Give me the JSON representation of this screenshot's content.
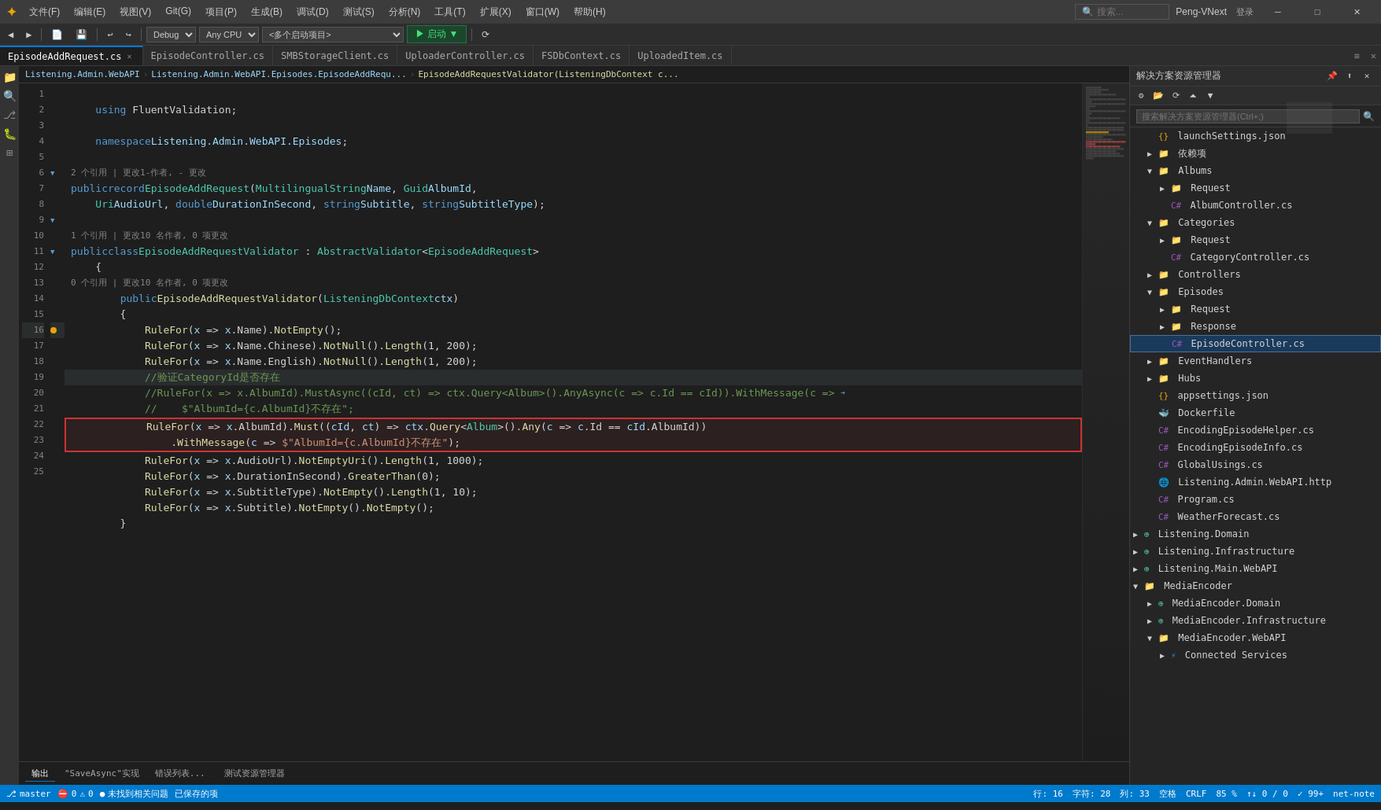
{
  "titleBar": {
    "logo": "✦",
    "menuItems": [
      "文件(F)",
      "编辑(E)",
      "视图(V)",
      "Git(G)",
      "项目(P)",
      "生成(B)",
      "调试(D)",
      "测试(S)",
      "分析(N)",
      "工具(T)",
      "扩展(X)",
      "窗口(W)",
      "帮助(H)"
    ],
    "searchPlaceholder": "搜索...",
    "windowTitle": "Peng-VNext",
    "loginText": "登录",
    "minBtn": "─",
    "maxBtn": "□",
    "closeBtn": "✕"
  },
  "toolbar": {
    "navBack": "◀",
    "navForward": "▶",
    "debugSelect": "Debug",
    "cpuSelect": "Any CPU",
    "startupSelect": "<多个启动项目>",
    "runBtn": "▶ 启动 ▼",
    "otherBtns": "⟳"
  },
  "tabs": [
    {
      "label": "EpisodeAddRequest.cs",
      "active": true,
      "modified": false
    },
    {
      "label": "EpisodeController.cs",
      "active": false,
      "modified": false
    },
    {
      "label": "SMBStorageClient.cs",
      "active": false
    },
    {
      "label": "UploaderController.cs",
      "active": false
    },
    {
      "label": "FSDbContext.cs",
      "active": false
    },
    {
      "label": "UploadedItem.cs",
      "active": false
    }
  ],
  "breadcrumb": {
    "namespace": "Listening.Admin.WebAPI",
    "path": "Listening.Admin.WebAPI.Episodes.EpisodeAddRequ...",
    "member": "EpisodeAddRequestValidator(ListeningDbContext c..."
  },
  "code": {
    "lines": [
      {
        "num": 1,
        "content": "",
        "gutter": ""
      },
      {
        "num": 2,
        "content": "    using FluentValidation;",
        "gutter": ""
      },
      {
        "num": 3,
        "content": "",
        "gutter": ""
      },
      {
        "num": 4,
        "content": "    namespace Listening.Admin.WebAPI.Episodes;",
        "gutter": ""
      },
      {
        "num": 5,
        "content": "",
        "gutter": ""
      },
      {
        "num": 6,
        "content": "public record EpisodeAddRequest(MultilingualString Name, Guid AlbumId,",
        "gutter": "",
        "refs": "2 个引用 | 更改1-作者, - 更改"
      },
      {
        "num": 7,
        "content": "    Uri AudioUrl, double DurationInSecond, string Subtitle, string SubtitleType);",
        "gutter": ""
      },
      {
        "num": 8,
        "content": "",
        "gutter": ""
      },
      {
        "num": 9,
        "content": "public class EpisodeAddRequestValidator : AbstractValidator<EpisodeAddRequest>",
        "gutter": "",
        "refs": "1 个引用 | 更改10 名作者, 0 项更改"
      },
      {
        "num": 10,
        "content": "    {",
        "gutter": ""
      },
      {
        "num": 11,
        "content": "        public EpisodeAddRequestValidator(ListeningDbContext ctx)",
        "gutter": "",
        "refs": "0 个引用 | 更改10 名作者, 0 项更改"
      },
      {
        "num": 12,
        "content": "        {",
        "gutter": ""
      },
      {
        "num": 13,
        "content": "            RuleFor(x => x.Name).NotEmpty();",
        "gutter": ""
      },
      {
        "num": 14,
        "content": "            RuleFor(x => x.Name.Chinese).NotNull().Length(1, 200);",
        "gutter": ""
      },
      {
        "num": 15,
        "content": "            RuleFor(x => x.Name.English).NotNull().Length(1, 200);",
        "gutter": ""
      },
      {
        "num": 16,
        "content": "            //验证CategoryId是否存在",
        "gutter": "dot",
        "current": true
      },
      {
        "num": 17,
        "content": "            //RuleFor(x => x.AlbumId).MustAsync((cId, ct) => ctx.Query<Album>().AnyAsync(c => c.Id == cId)).WithMessage(c =>",
        "gutter": ""
      },
      {
        "num": 18,
        "content": "            //    $\"AlbumId={c.AlbumId}不存在\";",
        "gutter": ""
      },
      {
        "num": 19,
        "content": "            RuleFor(x => x.AlbumId).Must((cId, ct) => ctx.Query<Album>().Any(c => c.Id == cId.AlbumId))",
        "gutter": ""
      },
      {
        "num": 20,
        "content": "                .WithMessage(c => $\"AlbumId={c.AlbumId}不存在\");",
        "gutter": ""
      },
      {
        "num": 21,
        "content": "            RuleFor(x => x.AudioUrl).NotEmptyUri().Length(1, 1000);",
        "gutter": ""
      },
      {
        "num": 22,
        "content": "            RuleFor(x => x.DurationInSecond).GreaterThan(0);",
        "gutter": ""
      },
      {
        "num": 23,
        "content": "            RuleFor(x => x.SubtitleType).NotEmpty().Length(1, 10);",
        "gutter": ""
      },
      {
        "num": 24,
        "content": "            RuleFor(x => x.Subtitle).NotEmpty().NotEmpty();",
        "gutter": ""
      },
      {
        "num": 25,
        "content": "        }",
        "gutter": ""
      }
    ],
    "highlightedLines": [
      19,
      20
    ]
  },
  "solutionExplorer": {
    "title": "解决方案资源管理器",
    "searchPlaceholder": "搜索解决方案资源管理器(Ctrl+;)",
    "tree": [
      {
        "level": 1,
        "type": "file",
        "label": "launchSettings.json",
        "icon": "json"
      },
      {
        "level": 1,
        "type": "folder",
        "label": "依赖项",
        "expanded": false,
        "icon": "folder"
      },
      {
        "level": 1,
        "type": "folder",
        "label": "Albums",
        "expanded": true,
        "icon": "folder"
      },
      {
        "level": 2,
        "type": "folder",
        "label": "Request",
        "expanded": false,
        "icon": "folder"
      },
      {
        "level": 2,
        "type": "cs",
        "label": "AlbumController.cs",
        "icon": "cs"
      },
      {
        "level": 1,
        "type": "folder",
        "label": "Categories",
        "expanded": true,
        "icon": "folder"
      },
      {
        "level": 2,
        "type": "folder",
        "label": "Request",
        "expanded": false,
        "icon": "folder"
      },
      {
        "level": 2,
        "type": "cs",
        "label": "CategoryController.cs",
        "icon": "cs"
      },
      {
        "level": 1,
        "type": "folder",
        "label": "Controllers",
        "expanded": false,
        "icon": "folder"
      },
      {
        "level": 1,
        "type": "folder",
        "label": "Episodes",
        "expanded": true,
        "icon": "folder"
      },
      {
        "level": 2,
        "type": "folder",
        "label": "Request",
        "expanded": true,
        "icon": "folder"
      },
      {
        "level": 2,
        "type": "folder",
        "label": "Response",
        "expanded": false,
        "icon": "folder"
      },
      {
        "level": 2,
        "type": "cs",
        "label": "EpisodeController.cs",
        "icon": "cs",
        "selected": true
      },
      {
        "level": 1,
        "type": "folder",
        "label": "EventHandlers",
        "expanded": false,
        "icon": "folder"
      },
      {
        "level": 1,
        "type": "folder",
        "label": "Hubs",
        "expanded": false,
        "icon": "folder"
      },
      {
        "level": 1,
        "type": "file",
        "label": "appsettings.json",
        "icon": "json"
      },
      {
        "level": 1,
        "type": "file",
        "label": "Dockerfile",
        "icon": "docker"
      },
      {
        "level": 1,
        "type": "cs",
        "label": "EncodingEpisodeHelper.cs",
        "icon": "cs"
      },
      {
        "level": 1,
        "type": "cs",
        "label": "EncodingEpisodeInfo.cs",
        "icon": "cs"
      },
      {
        "level": 1,
        "type": "cs",
        "label": "GlobalUsings.cs",
        "icon": "cs"
      },
      {
        "level": 1,
        "type": "http",
        "label": "Listening.Admin.WebAPI.http",
        "icon": "http"
      },
      {
        "level": 1,
        "type": "cs",
        "label": "Program.cs",
        "icon": "cs"
      },
      {
        "level": 1,
        "type": "cs",
        "label": "WeatherForecast.cs",
        "icon": "cs"
      },
      {
        "level": 0,
        "type": "project",
        "label": "Listening.Domain",
        "icon": "project"
      },
      {
        "level": 0,
        "type": "project",
        "label": "Listening.Infrastructure",
        "icon": "project"
      },
      {
        "level": 0,
        "type": "project",
        "label": "Listening.Main.WebAPI",
        "icon": "project"
      },
      {
        "level": 0,
        "type": "folder",
        "label": "MediaEncoder",
        "expanded": true,
        "icon": "folder"
      },
      {
        "level": 1,
        "type": "project",
        "label": "MediaEncoder.Domain",
        "icon": "project"
      },
      {
        "level": 1,
        "type": "project",
        "label": "MediaEncoder.Infrastructure",
        "icon": "project"
      },
      {
        "level": 1,
        "type": "folder",
        "label": "MediaEncoder.WebAPI",
        "expanded": true,
        "icon": "folder"
      },
      {
        "level": 2,
        "type": "folder",
        "label": "Connected Services",
        "expanded": false,
        "icon": "folder"
      }
    ]
  },
  "outputPanel": {
    "tabs": [
      "输出",
      "错误列表",
      "测试资源管理器"
    ],
    "content": "\"SaveAsync\"实现  错误列表..."
  },
  "statusBar": {
    "gitBranch": "master",
    "errors": "0",
    "warnings": "0",
    "line": "行: 16",
    "col": "字符: 28",
    "cols": "列: 33",
    "spaces": "空格",
    "encoding": "CRLF",
    "zoom": "85 %",
    "noIssues": "未找到相关问题",
    "savedItems": "已保存的项",
    "indicators": "↑↓ 0 / 0",
    "pct99": "✓ 99+",
    "net": "net-note"
  }
}
